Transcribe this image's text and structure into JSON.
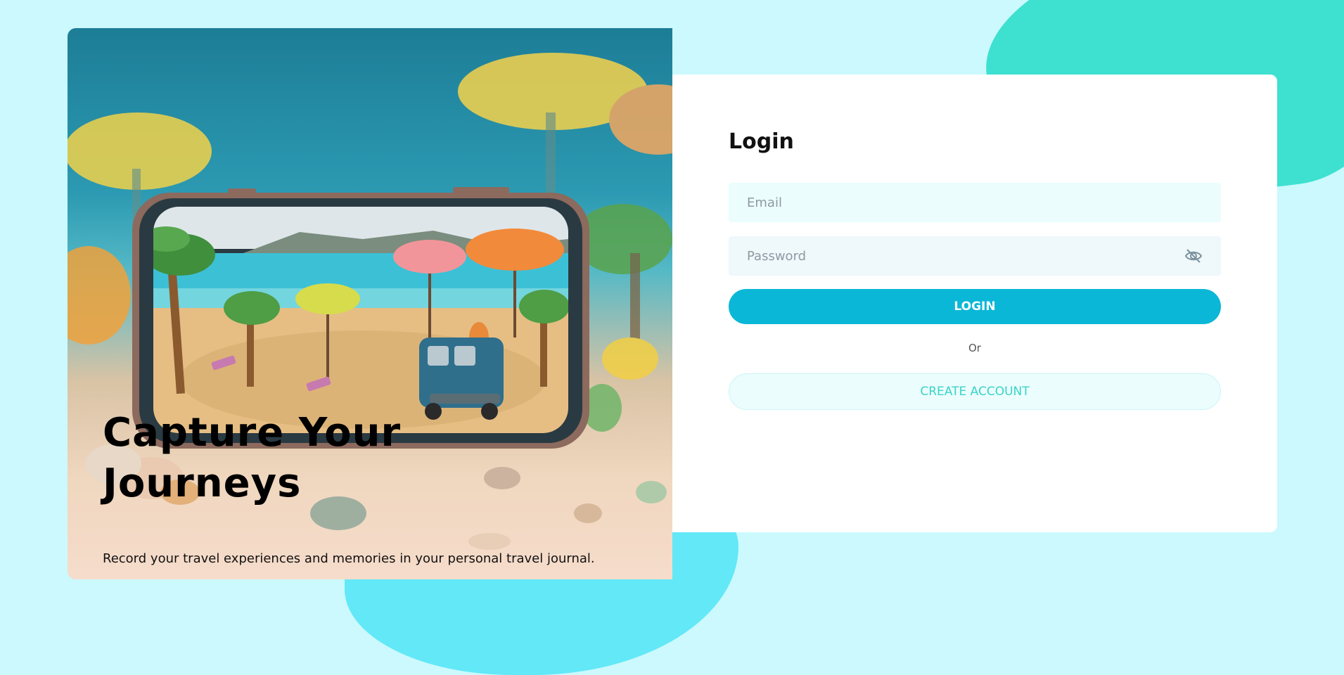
{
  "hero": {
    "title": "Capture Your Journeys",
    "subtitle": "Record your travel experiences and memories in your personal travel journal."
  },
  "login": {
    "heading": "Login",
    "email_placeholder": "Email",
    "password_placeholder": "Password",
    "login_label": "LOGIN",
    "or_label": "Or",
    "create_account_label": "CREATE ACCOUNT"
  },
  "colors": {
    "page_background": "#cbf9fd",
    "teal_blob": "#3ee1cf",
    "cyan_blob": "#62e8f7",
    "primary_button": "#0bb7d6",
    "secondary_text": "#3bd3c8"
  },
  "icons": {
    "password_toggle": "eye-off-icon"
  }
}
